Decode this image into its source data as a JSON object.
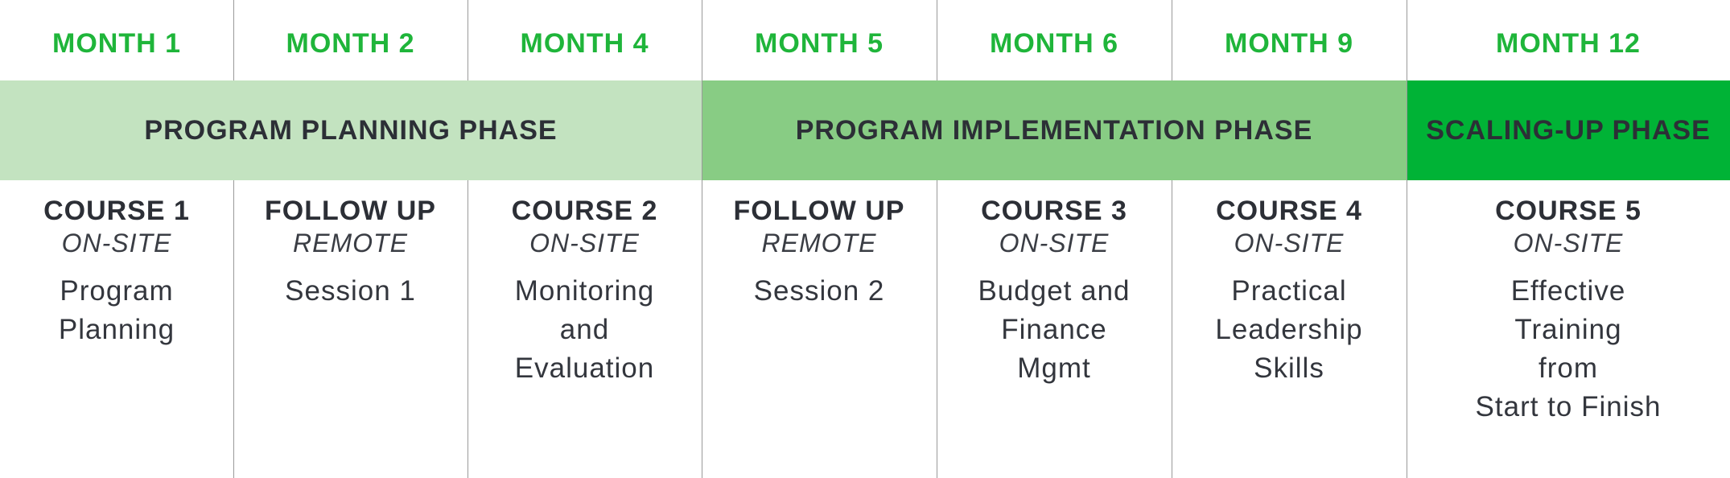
{
  "months": [
    "MONTH 1",
    "MONTH 2",
    "MONTH 4",
    "MONTH 5",
    "MONTH 6",
    "MONTH 9",
    "MONTH 12"
  ],
  "phases": [
    {
      "label": "PROGRAM PLANNING PHASE",
      "color": "#c3e3c0",
      "span": [
        0,
        3
      ]
    },
    {
      "label": "PROGRAM IMPLEMENTATION PHASE",
      "color": "#88cc84",
      "span": [
        3,
        6
      ]
    },
    {
      "label": "SCALING-UP PHASE",
      "color": "#00b336",
      "span": [
        6,
        7
      ]
    }
  ],
  "courses": [
    {
      "title": "COURSE 1",
      "mode": "ON-SITE",
      "desc": [
        "Program",
        "Planning"
      ]
    },
    {
      "title": "FOLLOW UP",
      "mode": "REMOTE",
      "desc": [
        "Session 1"
      ]
    },
    {
      "title": "COURSE 2",
      "mode": "ON-SITE",
      "desc": [
        "Monitoring",
        "and",
        "Evaluation"
      ]
    },
    {
      "title": "FOLLOW UP",
      "mode": "REMOTE",
      "desc": [
        "Session 2"
      ]
    },
    {
      "title": "COURSE 3",
      "mode": "ON-SITE",
      "desc": [
        "Budget and",
        "Finance",
        "Mgmt"
      ]
    },
    {
      "title": "COURSE 4",
      "mode": "ON-SITE",
      "desc": [
        "Practical",
        "Leadership",
        "Skills"
      ]
    },
    {
      "title": "COURSE 5",
      "mode": "ON-SITE",
      "desc": [
        "Effective",
        "Training",
        "from",
        "Start to Finish"
      ]
    }
  ],
  "colors": {
    "month_text": "#1fb53a",
    "body_text": "#2c2f36",
    "divider": "#9a9a9a"
  }
}
